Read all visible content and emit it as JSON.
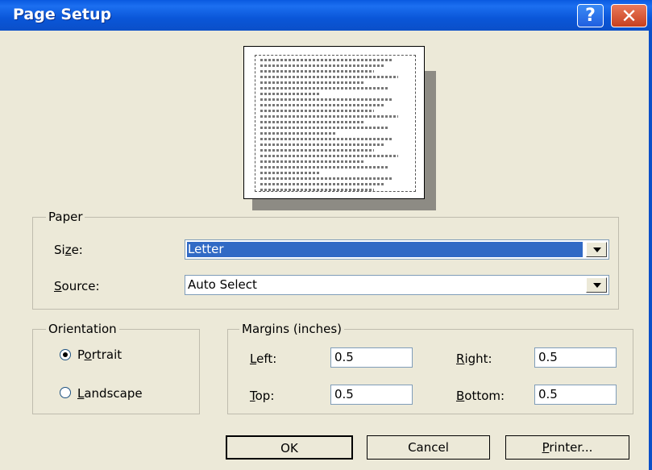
{
  "window": {
    "title": "Page Setup"
  },
  "titlebar": {
    "help_glyph": "?",
    "close_glyph": "✕"
  },
  "preview": {
    "line_count": 24
  },
  "paper": {
    "group_label": "Paper",
    "size_label": "Size:",
    "size_value": "Letter",
    "source_label": "Source:",
    "source_value": "Auto Select"
  },
  "orientation": {
    "group_label": "Orientation",
    "portrait_label": "Portrait",
    "landscape_label": "Landscape",
    "selected": "Portrait"
  },
  "margins": {
    "group_label": "Margins (inches)",
    "left_label": "Left:",
    "left_value": "0.5",
    "right_label": "Right:",
    "right_value": "0.5",
    "top_label": "Top:",
    "top_value": "0.5",
    "bottom_label": "Bottom:",
    "bottom_value": "0.5"
  },
  "buttons": {
    "ok": "OK",
    "cancel": "Cancel",
    "printer": "Printer..."
  }
}
